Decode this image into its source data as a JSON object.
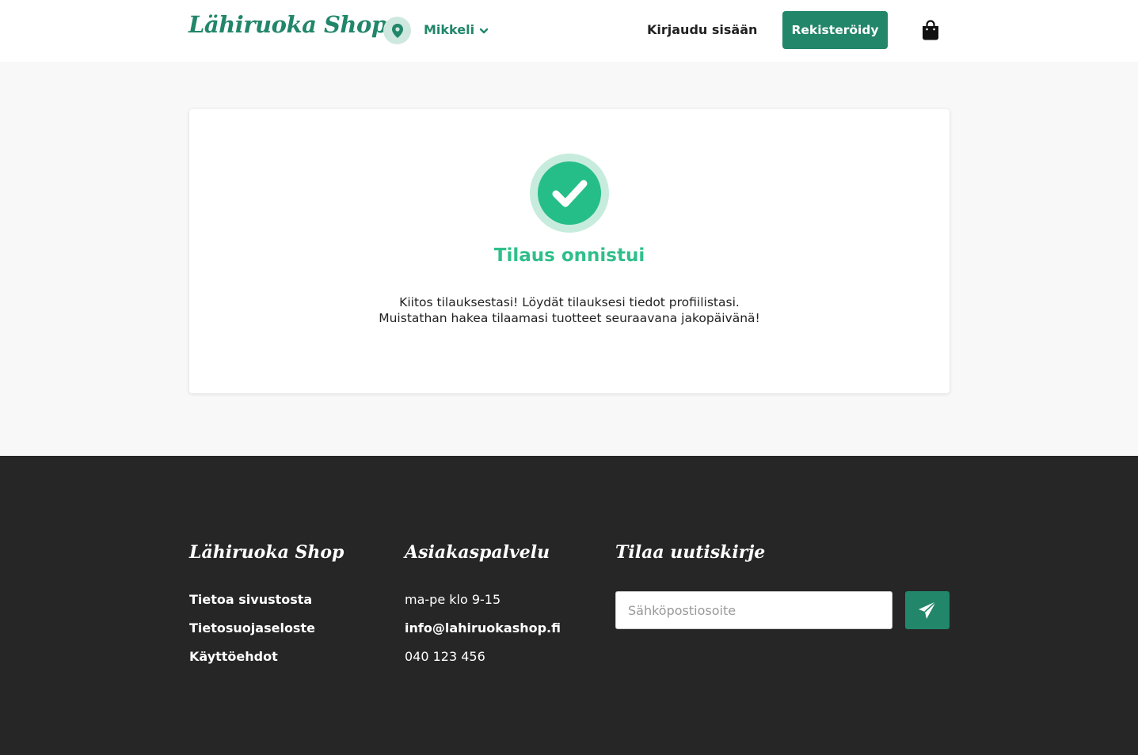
{
  "header": {
    "logo": "Lähiruoka Shop",
    "location": "Mikkeli",
    "login_label": "Kirjaudu sisään",
    "register_label": "Rekisteröidy"
  },
  "main": {
    "title": "Tilaus onnistui",
    "message_line1": "Kiitos tilauksestasi! Löydät tilauksesi tiedot profiilistasi.",
    "message_line2": "Muistathan hakea tilaamasi tuotteet seuraavana jakopäivänä!"
  },
  "footer": {
    "col1": {
      "heading": "Lähiruoka Shop",
      "links": [
        "Tietoa sivustosta",
        "Tietosuojaseloste",
        "Käyttöehdot"
      ]
    },
    "col2": {
      "heading": "Asiakaspalvelu",
      "hours": "ma-pe klo 9-15",
      "email": "info@lahiruokashop.fi",
      "phone": "040 123 456"
    },
    "col3": {
      "heading": "Tilaa uutiskirje",
      "email_placeholder": "Sähköpostiosoite"
    }
  },
  "colors": {
    "brand_green": "#22866a",
    "success_green": "#2fbf8b",
    "footer_bg": "#262626",
    "page_bg": "#f8f8f8"
  },
  "icons": {
    "location": "map-pin-icon",
    "dropdown": "chevron-down-icon",
    "cart": "shopping-bag-icon",
    "success": "check-circle-icon",
    "send": "paper-plane-icon"
  }
}
